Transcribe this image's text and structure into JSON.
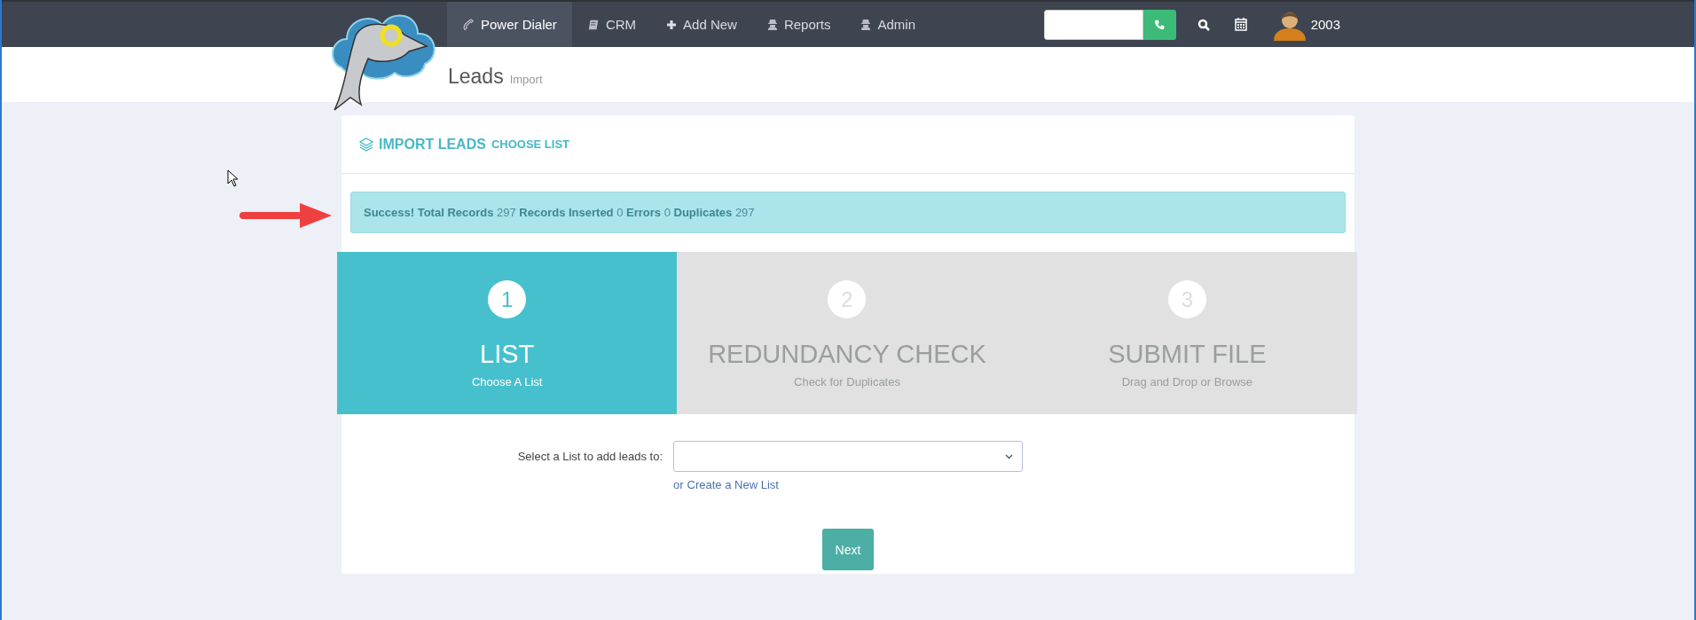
{
  "nav": {
    "items": [
      {
        "label": "Power Dialer",
        "selected": true
      },
      {
        "label": "CRM",
        "selected": false
      },
      {
        "label": "Add New",
        "selected": false
      },
      {
        "label": "Reports",
        "selected": false
      },
      {
        "label": "Admin",
        "selected": false
      }
    ],
    "user": "2003"
  },
  "header": {
    "title": "Leads",
    "subtitle": "Import"
  },
  "card": {
    "title": "IMPORT LEADS",
    "subtitle": "CHOOSE LIST",
    "alert": "**Success! Total Records** 297 **Records Inserted** 0 **Errors** 0 **Duplicates** 297",
    "steps": [
      {
        "number": "1",
        "title": "LIST",
        "subtitle": "Choose A List",
        "selected": true
      },
      {
        "number": "2",
        "title": "REDUNDANCY CHECK",
        "subtitle": "Check for Duplicates",
        "selected": false
      },
      {
        "number": "3",
        "title": "SUBMIT FILE",
        "subtitle": "Drag and Drop or Browse",
        "selected": false
      }
    ],
    "form": {
      "label": "Select a List to add leads to:",
      "link_prefix": "or",
      "link": "Create a New List",
      "button": "Next"
    }
  }
}
